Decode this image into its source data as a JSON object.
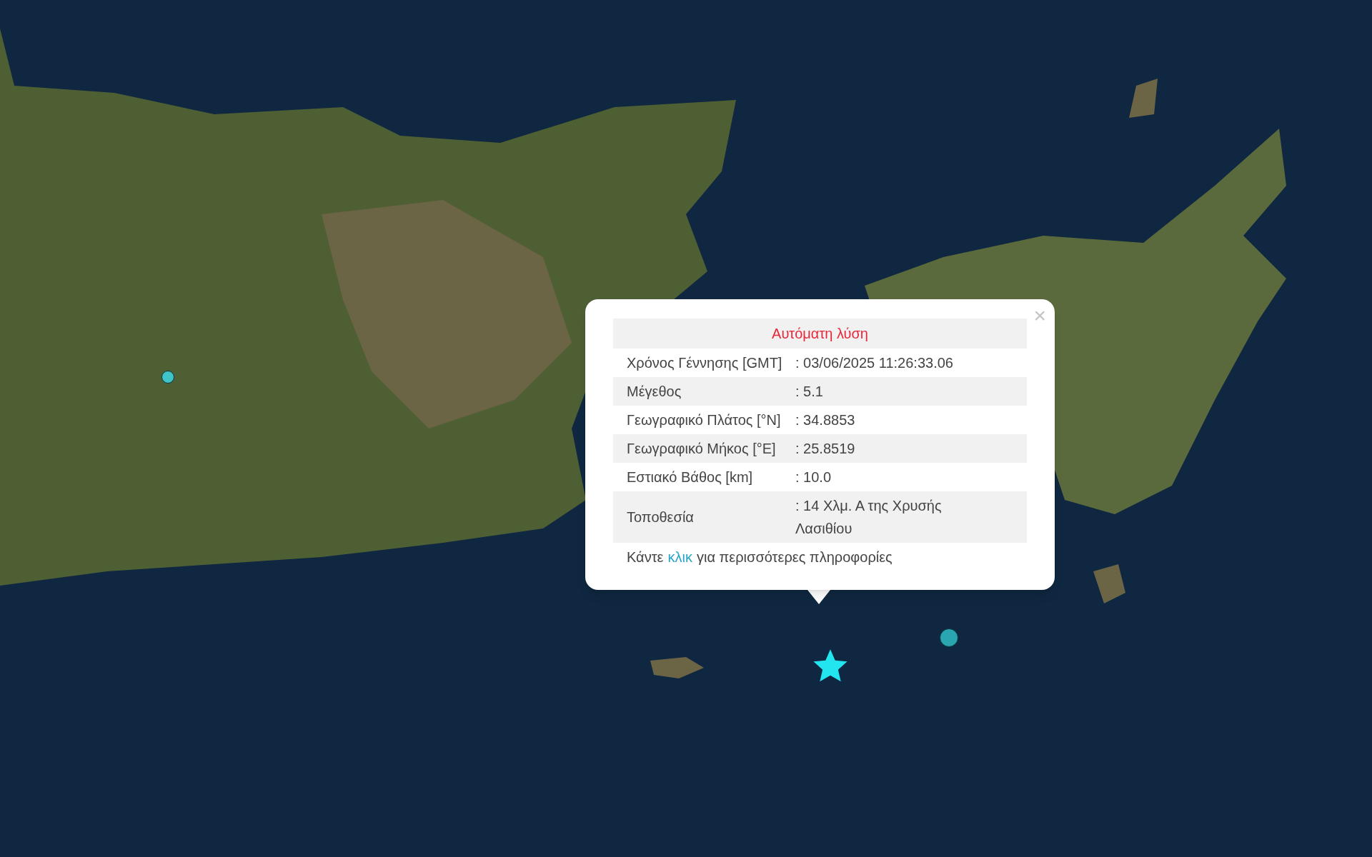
{
  "popup": {
    "title": "Αυτόματη λύση",
    "close": "×",
    "rows": [
      {
        "label": "Χρόνος Γέννησης [GMT]",
        "value": ": 03/06/2025 11:26:33.06"
      },
      {
        "label": "Μέγεθος",
        "value": ": 5.1"
      },
      {
        "label": "Γεωγραφικό Πλάτος [°N]",
        "value": ": 34.8853"
      },
      {
        "label": "Γεωγραφικό Μήκος [°E]",
        "value": ": 25.8519"
      },
      {
        "label": "Εστιακό Βάθος [km]",
        "value": ": 10.0"
      },
      {
        "label": "Τοποθεσία",
        "value": ": 14 Χλμ. Α της Χρυσής Λασιθίου"
      }
    ],
    "footer": {
      "before": "Κάντε",
      "link": "κλικ",
      "after": "για περισσότερες πληροφορίες"
    }
  },
  "markers": [
    {
      "kind": "circle",
      "color": "#3fc4c9"
    },
    {
      "kind": "circle",
      "color": "#2aa6b0"
    },
    {
      "kind": "star",
      "color": "#22e5f0"
    }
  ]
}
